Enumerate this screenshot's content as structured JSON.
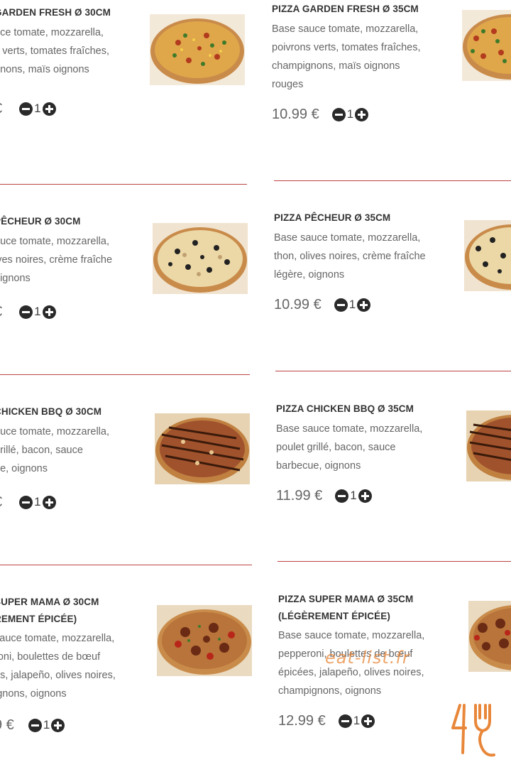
{
  "left_items": [
    {
      "title": "GARDEN FRESH Ø 30CM",
      "desc": [
        "uce tomate, mozzarella,",
        "s verts, tomates fraîches,",
        "gnons, maïs oignons"
      ],
      "price": "€",
      "qty": "1"
    },
    {
      "title": "PÊCHEUR Ø 30CM",
      "desc": [
        "auce tomate, mozzarella,",
        "ives noires, crème fraîche",
        "oignons"
      ],
      "price": "€",
      "qty": "1"
    },
    {
      "title": "CHICKEN BBQ Ø 30CM",
      "desc": [
        "auce tomate, mozzarella,",
        "grillé, bacon, sauce",
        "ue, oignons"
      ],
      "price": "€",
      "qty": "1"
    },
    {
      "title": "SUPER MAMA Ø 30CM",
      "title2": "REMENT ÉPICÉE)",
      "desc": [
        "sauce tomate, mozzarella,",
        "roni, boulettes de bœuf",
        "es, jalapeño, olives noires,",
        "ignons, oignons"
      ],
      "price": "9 €",
      "qty": "1"
    }
  ],
  "right_items": [
    {
      "title": "PIZZA GARDEN FRESH Ø 35CM",
      "desc": [
        "Base sauce tomate, mozzarella,",
        "poivrons verts, tomates fraîches,",
        "champignons, maïs oignons",
        "rouges"
      ],
      "price": "10.99 €",
      "qty": "1"
    },
    {
      "title": "PIZZA PÊCHEUR Ø 35CM",
      "desc": [
        "Base sauce tomate, mozzarella,",
        "thon, olives noires, crème fraîche",
        "légère, oignons"
      ],
      "price": "10.99 €",
      "qty": "1"
    },
    {
      "title": "PIZZA CHICKEN BBQ Ø 35CM",
      "desc": [
        "Base sauce tomate, mozzarella,",
        "poulet grillé, bacon, sauce",
        "barbecue, oignons"
      ],
      "price": "11.99 €",
      "qty": "1"
    },
    {
      "title": "PIZZA SUPER MAMA Ø 35CM",
      "title2": "(LÉGÈREMENT ÉPICÉE)",
      "desc": [
        "Base sauce tomate, mozzarella,",
        "pepperoni, boulettes de bœuf",
        "épicées, jalapeño, olives noires,",
        "champignons, oignons"
      ],
      "price": "12.99 €",
      "qty": "1"
    }
  ],
  "watermark": "eat-list.fr",
  "colors": {
    "divider": "#b22222",
    "logo": "#e8873a",
    "button": "#2a2a2a"
  },
  "icons": {
    "decrease": "minus-circle-icon",
    "increase": "plus-circle-icon",
    "logo": "fork-logo-icon"
  }
}
